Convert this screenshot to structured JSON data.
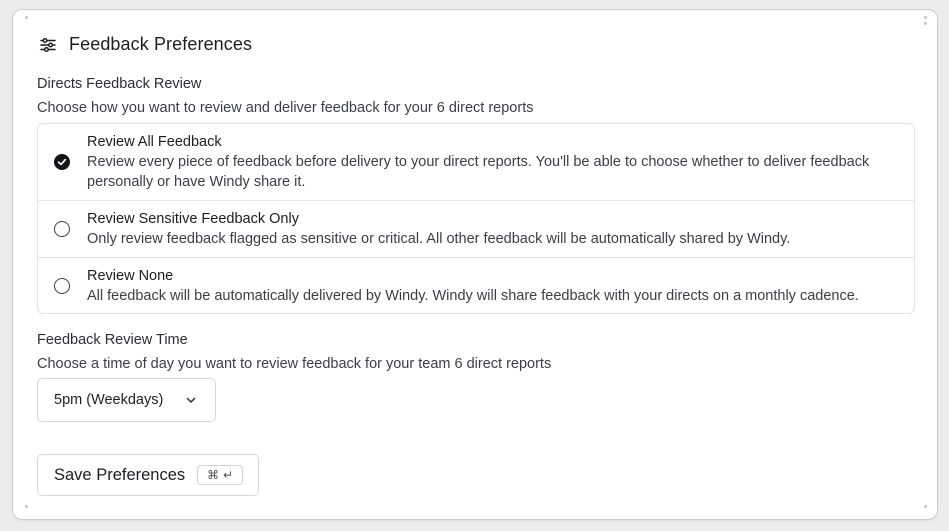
{
  "header": {
    "title": "Feedback Preferences",
    "icon": "sliders-icon"
  },
  "directs_review": {
    "title": "Directs Feedback Review",
    "description": "Choose how you want to review and deliver feedback for your 6 direct reports",
    "options": [
      {
        "title": "Review All Feedback",
        "description": "Review every piece of feedback before delivery to your direct reports. You'll be able to choose whether to deliver feedback personally or have Windy share it.",
        "selected": true
      },
      {
        "title": "Review Sensitive Feedback Only",
        "description": "Only review feedback flagged as sensitive or critical. All other feedback will be automatically shared by Windy.",
        "selected": false
      },
      {
        "title": "Review None",
        "description": "All feedback will be automatically delivered by Windy. Windy will share feedback with your directs on a monthly cadence.",
        "selected": false
      }
    ]
  },
  "review_time": {
    "title": "Feedback Review Time",
    "description": "Choose a time of day you want to review feedback for your team 6 direct reports",
    "selected_value": "5pm (Weekdays)"
  },
  "save": {
    "label": "Save Preferences",
    "shortcut_cmd": "⌘",
    "shortcut_enter": "↵"
  },
  "colors": {
    "selected_radio": "#111418",
    "border": "#dfe1e6",
    "card_border": "#c9ccd4"
  }
}
